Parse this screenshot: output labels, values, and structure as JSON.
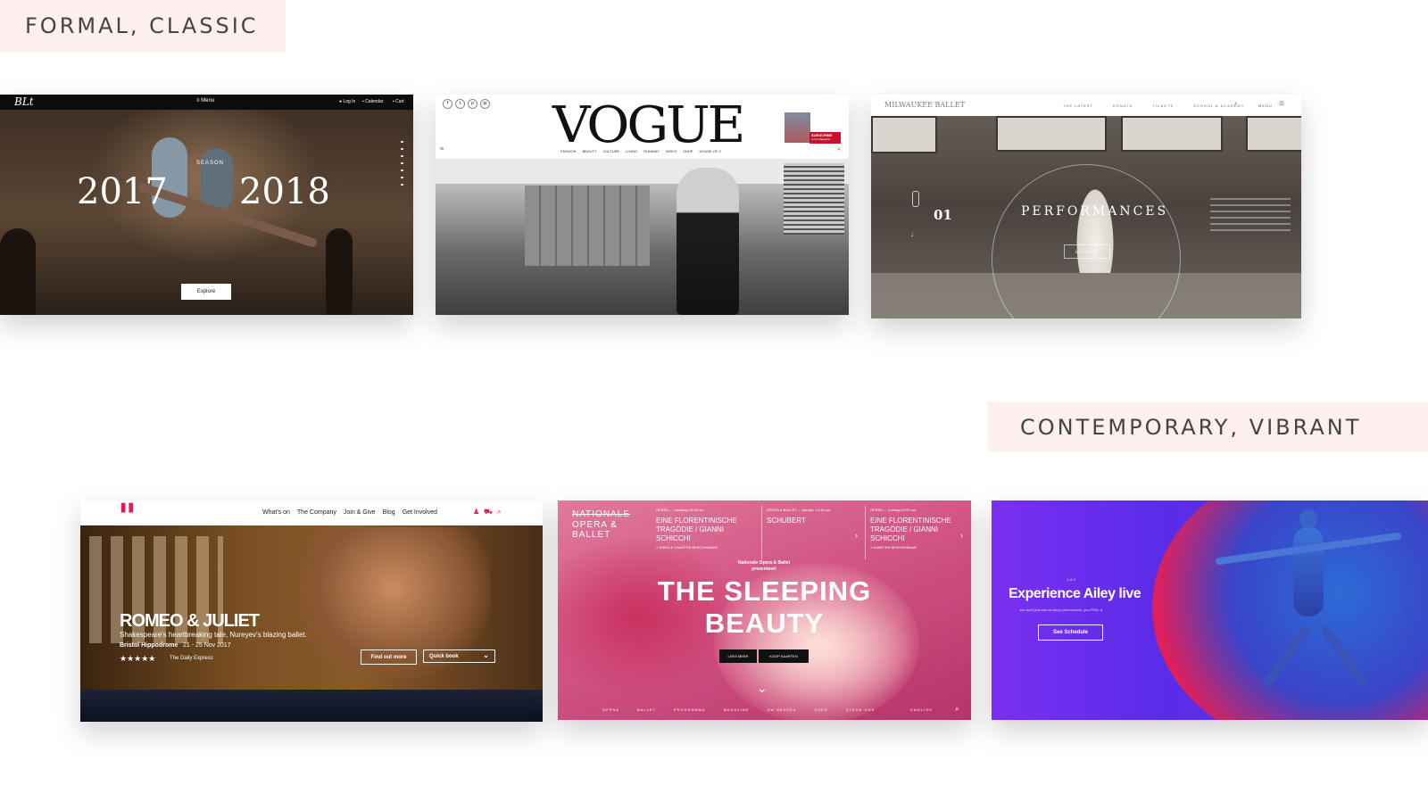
{
  "labels": {
    "formal": "FORMAL, CLASSIC",
    "contemporary": "CONTEMPORARY, VIBRANT"
  },
  "ballet": {
    "logo": "BLt",
    "menu": "Menu",
    "login": "Log In",
    "calendar": "Calendar",
    "cart": "Cart",
    "season": "SEASON",
    "year_left": "2017",
    "year_right": "2018",
    "explore": "Explore"
  },
  "vogue": {
    "logo": "VOGUE",
    "nav": [
      "FASHION",
      "BEAUTY",
      "CULTURE",
      "LIVING",
      "RUNWAY",
      "VIDEO",
      "SHOP",
      "HOUSE OF Z"
    ],
    "subscribe": "SUBSCRIBE",
    "subscribe_sub": "to the Magazine"
  },
  "milwaukee": {
    "brand": "MILWAUKEE BALLET",
    "nav": [
      "THE LATEST",
      "DONATE",
      "TICKETS",
      "SCHOOL & ACADEMY"
    ],
    "menu": "MENU",
    "number": "01",
    "title": "PERFORMANCES",
    "button": "EXPLORE"
  },
  "romeo": {
    "nav": [
      "What's on",
      "The Company",
      "Join & Give",
      "Blog",
      "Get Involved"
    ],
    "title": "ROMEO & JULIET",
    "subtitle": "Shakespeare's heartbreaking tale, Nureyev's blazing ballet.",
    "venue": "Bristol Hippodrome",
    "dates": "21 - 25 Nov 2017",
    "stars": "★★★★★",
    "review": "The Daily Express",
    "find_out": "Find out more",
    "quick_book": "Quick book"
  },
  "nationale": {
    "brand_line1": "NATIONALE",
    "brand_line2": "OPERA &",
    "brand_line3": "BALLET",
    "col1_tag": "OPERA — Vandaag 20:00 uur",
    "col1_title": "EINE FLORENTINISCHE TRAGÖDIE / GIANNI SCHICCHI",
    "col1_note": "ENKELE KAARTEN BESCHIKBAAR",
    "col2_tag": "OPERA & BALLET — Morgen 14:15 uur",
    "col2_title": "SCHUBERT",
    "col3_tag": "OPERA — Zondag 20:00 uur",
    "col3_title": "EINE FLORENTINISCHE TRAGÖDIE / GIANNI SCHICCHI",
    "col3_note": "KAARTEN BESCHIKBAAR",
    "presents": "Nationale Opera & Ballet presenteert",
    "title_line1": "THE SLEEPING",
    "title_line2": "BEAUTY",
    "btn_more": "LEES MEER",
    "btn_buy": "KOOP KAARTEN",
    "footer": [
      "OPERA",
      "BALLET",
      "PROGRAMMA",
      "MAGAZINE",
      "UW BEZOEK",
      "OVER",
      "STEUN ONS",
      "ENGLISH"
    ]
  },
  "ailey": {
    "counter": "1 of 3",
    "title": "Experience Ailey live",
    "subtitle": "You don't just see an Ailey performance, you FEEL it.",
    "button": "See Schedule"
  }
}
